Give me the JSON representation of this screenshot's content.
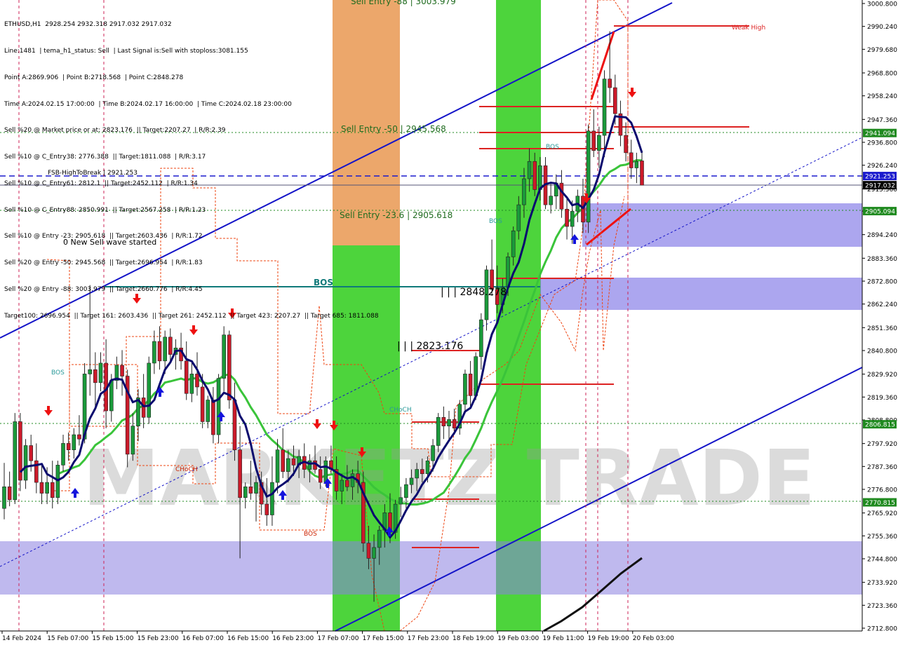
{
  "header": {
    "symbol_line": "ETHUSD,H1  2928.254 2932.318 2917.032 2917.032",
    "info_lines": [
      "Line:1481  | tema_h1_status: Sell  | Last Signal is:Sell with stoploss:3081.155",
      "Point A:2869.906  | Point B:2718.568  | Point C:2848.278",
      "Time A:2024.02.15 17:00:00  | Time B:2024.02.17 16:00:00  | Time C:2024.02.18 23:00:00",
      "Sell %20 @ Market price or at: 2823.176  || Target:2207.27  | R/R:2.39",
      "Sell %10 @ C_Entry38: 2776.388  || Target:1811.088  | R/R:3.17",
      "Sell %10 @ C_Entry61: 2812.1  || Target:2452.112  | R/R:1.34",
      "Sell %10 @ C_Entry88: 2850.991  || Target:2567.258  | R/R:1.23",
      "Sell %10 @ Entry -23: 2905.618  || Target:2603.436  | R/R:1.72",
      "Sell %20 @ Entry -50: 2945.568  || Target:2696.954  | R/R:1.83",
      "Sell %20 @ Entry -88: 3003.979  || Target:2660.776  | R/R:4.45",
      "Target100: 2696.954  || Target 161: 2603.436  || Target 261: 2452.112  || Target 423: 2207.27  || Target 685: 1811.088"
    ]
  },
  "watermark": "MARKETZ TRADE",
  "chart_data": {
    "type": "candlestick",
    "symbol": "ETHUSD",
    "timeframe": "H1",
    "ohlc_last": {
      "open": 2928.254,
      "high": 2932.318,
      "low": 2917.032,
      "close": 2917.032
    },
    "ylim": [
      2712.8,
      3000.8
    ],
    "y_ticks": [
      "3000.800",
      "2990.240",
      "2979.680",
      "2968.800",
      "2958.240",
      "2947.360",
      "2936.800",
      "2926.240",
      "2915.360",
      "2905.094",
      "2894.240",
      "2883.360",
      "2872.800",
      "2862.240",
      "2851.360",
      "2840.800",
      "2829.920",
      "2819.360",
      "2808.800",
      "2797.920",
      "2787.360",
      "2776.800",
      "2765.920",
      "2755.360",
      "2744.800",
      "2733.920",
      "2723.360",
      "2712.800"
    ],
    "x_ticks": [
      "14 Feb 2024",
      "15 Feb 07:00",
      "15 Feb 15:00",
      "15 Feb 23:00",
      "16 Feb 07:00",
      "16 Feb 15:00",
      "16 Feb 23:00",
      "17 Feb 07:00",
      "17 Feb 15:00",
      "17 Feb 23:00",
      "18 Feb 19:00",
      "19 Feb 03:00",
      "19 Feb 11:00",
      "19 Feb 19:00",
      "20 Feb 03:00"
    ],
    "price_badges": [
      {
        "value": "2941.094",
        "color": "#1f8a1f"
      },
      {
        "value": "2921.253",
        "color": "#1a1acd"
      },
      {
        "value": "2917.032",
        "color": "#000000"
      },
      {
        "value": "2905.094",
        "color": "#1f8a1f"
      },
      {
        "value": "2806.815",
        "color": "#1f8a1f"
      },
      {
        "value": "2770.815",
        "color": "#1f8a1f"
      }
    ],
    "annotations": [
      {
        "text": "Sell Entry -88 | 3003.979",
        "color": "#1f6b1f"
      },
      {
        "text": "Sell Entry -50 | 2945.568",
        "color": "#1f6b1f"
      },
      {
        "text": "Sell Entry -23.6 | 2905.618",
        "color": "#1f6b1f"
      },
      {
        "text": "FSB-HighToBreak  |  2921.253",
        "color": "#000000"
      },
      {
        "text": "0 New Sell wave started",
        "color": "#000000"
      },
      {
        "text": "BOS",
        "color": "#0f7a7a"
      },
      {
        "text": "BOS",
        "color": "#2a9a9a"
      },
      {
        "text": "BOS",
        "color": "#2a9a9a"
      },
      {
        "text": "BOS",
        "color": "#2a9a9a"
      },
      {
        "text": "BOS",
        "color": "#cc2200"
      },
      {
        "text": "CHoCH",
        "color": "#2a9a9a"
      },
      {
        "text": "CHoCH",
        "color": "#cc2200"
      },
      {
        "text": "| | | 2848.278",
        "color": "#000000"
      },
      {
        "text": "| | | 2823.176",
        "color": "#000000"
      },
      {
        "text": "Weak High",
        "color": "#dd2222"
      }
    ],
    "candles": [
      {
        "o": 2768,
        "h": 2789,
        "l": 2763,
        "c": 2778
      },
      {
        "o": 2778,
        "h": 2785,
        "l": 2769,
        "c": 2772
      },
      {
        "o": 2772,
        "h": 2812,
        "l": 2770,
        "c": 2808
      },
      {
        "o": 2808,
        "h": 2812,
        "l": 2776,
        "c": 2781
      },
      {
        "o": 2781,
        "h": 2800,
        "l": 2777,
        "c": 2797
      },
      {
        "o": 2797,
        "h": 2802,
        "l": 2785,
        "c": 2790
      },
      {
        "o": 2790,
        "h": 2798,
        "l": 2775,
        "c": 2780
      },
      {
        "o": 2780,
        "h": 2788,
        "l": 2770,
        "c": 2775
      },
      {
        "o": 2775,
        "h": 2787,
        "l": 2770,
        "c": 2780
      },
      {
        "o": 2780,
        "h": 2790,
        "l": 2768,
        "c": 2773
      },
      {
        "o": 2773,
        "h": 2790,
        "l": 2770,
        "c": 2788
      },
      {
        "o": 2788,
        "h": 2802,
        "l": 2785,
        "c": 2798
      },
      {
        "o": 2798,
        "h": 2803,
        "l": 2790,
        "c": 2795
      },
      {
        "o": 2795,
        "h": 2805,
        "l": 2791,
        "c": 2802
      },
      {
        "o": 2802,
        "h": 2811,
        "l": 2797,
        "c": 2800
      },
      {
        "o": 2800,
        "h": 2835,
        "l": 2798,
        "c": 2830
      },
      {
        "o": 2830,
        "h": 2871,
        "l": 2820,
        "c": 2832
      },
      {
        "o": 2832,
        "h": 2840,
        "l": 2815,
        "c": 2826
      },
      {
        "o": 2826,
        "h": 2840,
        "l": 2822,
        "c": 2835
      },
      {
        "o": 2835,
        "h": 2846,
        "l": 2805,
        "c": 2813
      },
      {
        "o": 2813,
        "h": 2830,
        "l": 2808,
        "c": 2827
      },
      {
        "o": 2827,
        "h": 2838,
        "l": 2823,
        "c": 2834
      },
      {
        "o": 2834,
        "h": 2841,
        "l": 2820,
        "c": 2829
      },
      {
        "o": 2829,
        "h": 2832,
        "l": 2787,
        "c": 2793
      },
      {
        "o": 2793,
        "h": 2812,
        "l": 2790,
        "c": 2806
      },
      {
        "o": 2806,
        "h": 2823,
        "l": 2799,
        "c": 2819
      },
      {
        "o": 2819,
        "h": 2830,
        "l": 2805,
        "c": 2810
      },
      {
        "o": 2810,
        "h": 2838,
        "l": 2807,
        "c": 2835
      },
      {
        "o": 2835,
        "h": 2850,
        "l": 2830,
        "c": 2845
      },
      {
        "o": 2845,
        "h": 2852,
        "l": 2832,
        "c": 2836
      },
      {
        "o": 2836,
        "h": 2850,
        "l": 2830,
        "c": 2847
      },
      {
        "o": 2847,
        "h": 2851,
        "l": 2835,
        "c": 2839
      },
      {
        "o": 2839,
        "h": 2846,
        "l": 2832,
        "c": 2842
      },
      {
        "o": 2842,
        "h": 2849,
        "l": 2832,
        "c": 2836
      },
      {
        "o": 2836,
        "h": 2845,
        "l": 2818,
        "c": 2821
      },
      {
        "o": 2821,
        "h": 2835,
        "l": 2817,
        "c": 2830
      },
      {
        "o": 2830,
        "h": 2840,
        "l": 2820,
        "c": 2824
      },
      {
        "o": 2824,
        "h": 2830,
        "l": 2805,
        "c": 2808
      },
      {
        "o": 2808,
        "h": 2820,
        "l": 2805,
        "c": 2818
      },
      {
        "o": 2818,
        "h": 2824,
        "l": 2798,
        "c": 2802
      },
      {
        "o": 2802,
        "h": 2830,
        "l": 2798,
        "c": 2828
      },
      {
        "o": 2828,
        "h": 2852,
        "l": 2822,
        "c": 2848
      },
      {
        "o": 2848,
        "h": 2850,
        "l": 2814,
        "c": 2818
      },
      {
        "o": 2818,
        "h": 2826,
        "l": 2790,
        "c": 2795
      },
      {
        "o": 2795,
        "h": 2806,
        "l": 2745,
        "c": 2773
      },
      {
        "o": 2773,
        "h": 2780,
        "l": 2768,
        "c": 2778
      },
      {
        "o": 2778,
        "h": 2790,
        "l": 2772,
        "c": 2775
      },
      {
        "o": 2775,
        "h": 2783,
        "l": 2762,
        "c": 2780
      },
      {
        "o": 2780,
        "h": 2785,
        "l": 2765,
        "c": 2770
      },
      {
        "o": 2770,
        "h": 2782,
        "l": 2760,
        "c": 2765
      },
      {
        "o": 2765,
        "h": 2792,
        "l": 2760,
        "c": 2780
      },
      {
        "o": 2780,
        "h": 2800,
        "l": 2775,
        "c": 2795
      },
      {
        "o": 2795,
        "h": 2805,
        "l": 2782,
        "c": 2785
      },
      {
        "o": 2785,
        "h": 2795,
        "l": 2780,
        "c": 2791
      },
      {
        "o": 2791,
        "h": 2797,
        "l": 2783,
        "c": 2788
      },
      {
        "o": 2788,
        "h": 2795,
        "l": 2782,
        "c": 2792
      },
      {
        "o": 2792,
        "h": 2798,
        "l": 2782,
        "c": 2786
      },
      {
        "o": 2786,
        "h": 2793,
        "l": 2780,
        "c": 2790
      },
      {
        "o": 2790,
        "h": 2797,
        "l": 2784,
        "c": 2786
      },
      {
        "o": 2786,
        "h": 2792,
        "l": 2777,
        "c": 2780
      },
      {
        "o": 2780,
        "h": 2792,
        "l": 2778,
        "c": 2790
      },
      {
        "o": 2790,
        "h": 2797,
        "l": 2784,
        "c": 2786
      },
      {
        "o": 2786,
        "h": 2792,
        "l": 2772,
        "c": 2776
      },
      {
        "o": 2776,
        "h": 2784,
        "l": 2770,
        "c": 2781
      },
      {
        "o": 2781,
        "h": 2788,
        "l": 2776,
        "c": 2778
      },
      {
        "o": 2778,
        "h": 2786,
        "l": 2772,
        "c": 2784
      },
      {
        "o": 2784,
        "h": 2790,
        "l": 2775,
        "c": 2780
      },
      {
        "o": 2780,
        "h": 2785,
        "l": 2748,
        "c": 2752
      },
      {
        "o": 2752,
        "h": 2760,
        "l": 2740,
        "c": 2745
      },
      {
        "o": 2745,
        "h": 2756,
        "l": 2725,
        "c": 2750
      },
      {
        "o": 2750,
        "h": 2760,
        "l": 2742,
        "c": 2758
      },
      {
        "o": 2758,
        "h": 2770,
        "l": 2750,
        "c": 2766
      },
      {
        "o": 2766,
        "h": 2775,
        "l": 2752,
        "c": 2757
      },
      {
        "o": 2757,
        "h": 2772,
        "l": 2754,
        "c": 2770
      },
      {
        "o": 2770,
        "h": 2778,
        "l": 2764,
        "c": 2773
      },
      {
        "o": 2773,
        "h": 2782,
        "l": 2768,
        "c": 2779
      },
      {
        "o": 2779,
        "h": 2786,
        "l": 2775,
        "c": 2782
      },
      {
        "o": 2782,
        "h": 2789,
        "l": 2776,
        "c": 2786
      },
      {
        "o": 2786,
        "h": 2791,
        "l": 2780,
        "c": 2784
      },
      {
        "o": 2784,
        "h": 2792,
        "l": 2780,
        "c": 2790
      },
      {
        "o": 2790,
        "h": 2800,
        "l": 2785,
        "c": 2797
      },
      {
        "o": 2797,
        "h": 2812,
        "l": 2794,
        "c": 2810
      },
      {
        "o": 2810,
        "h": 2815,
        "l": 2800,
        "c": 2806
      },
      {
        "o": 2806,
        "h": 2813,
        "l": 2800,
        "c": 2809
      },
      {
        "o": 2809,
        "h": 2814,
        "l": 2802,
        "c": 2805
      },
      {
        "o": 2805,
        "h": 2818,
        "l": 2802,
        "c": 2816
      },
      {
        "o": 2816,
        "h": 2832,
        "l": 2812,
        "c": 2830
      },
      {
        "o": 2830,
        "h": 2836,
        "l": 2815,
        "c": 2820
      },
      {
        "o": 2820,
        "h": 2840,
        "l": 2818,
        "c": 2838
      },
      {
        "o": 2838,
        "h": 2858,
        "l": 2832,
        "c": 2855
      },
      {
        "o": 2855,
        "h": 2880,
        "l": 2850,
        "c": 2878
      },
      {
        "o": 2878,
        "h": 2892,
        "l": 2866,
        "c": 2869
      },
      {
        "o": 2869,
        "h": 2880,
        "l": 2858,
        "c": 2862
      },
      {
        "o": 2862,
        "h": 2874,
        "l": 2858,
        "c": 2870
      },
      {
        "o": 2870,
        "h": 2886,
        "l": 2866,
        "c": 2884
      },
      {
        "o": 2884,
        "h": 2898,
        "l": 2880,
        "c": 2896
      },
      {
        "o": 2896,
        "h": 2912,
        "l": 2892,
        "c": 2908
      },
      {
        "o": 2908,
        "h": 2925,
        "l": 2902,
        "c": 2920
      },
      {
        "o": 2920,
        "h": 2934,
        "l": 2914,
        "c": 2928
      },
      {
        "o": 2928,
        "h": 2932,
        "l": 2912,
        "c": 2915
      },
      {
        "o": 2915,
        "h": 2930,
        "l": 2910,
        "c": 2926
      },
      {
        "o": 2926,
        "h": 2930,
        "l": 2906,
        "c": 2908
      },
      {
        "o": 2908,
        "h": 2918,
        "l": 2904,
        "c": 2912
      },
      {
        "o": 2912,
        "h": 2922,
        "l": 2906,
        "c": 2918
      },
      {
        "o": 2918,
        "h": 2924,
        "l": 2902,
        "c": 2906
      },
      {
        "o": 2906,
        "h": 2912,
        "l": 2892,
        "c": 2898
      },
      {
        "o": 2898,
        "h": 2910,
        "l": 2890,
        "c": 2905
      },
      {
        "o": 2905,
        "h": 2915,
        "l": 2900,
        "c": 2912
      },
      {
        "o": 2912,
        "h": 2920,
        "l": 2895,
        "c": 2900
      },
      {
        "o": 2900,
        "h": 2945,
        "l": 2895,
        "c": 2942
      },
      {
        "o": 2942,
        "h": 2952,
        "l": 2930,
        "c": 2933
      },
      {
        "o": 2933,
        "h": 2944,
        "l": 2925,
        "c": 2940
      },
      {
        "o": 2940,
        "h": 2970,
        "l": 2930,
        "c": 2966
      },
      {
        "o": 2966,
        "h": 2988,
        "l": 2955,
        "c": 2962
      },
      {
        "o": 2962,
        "h": 2968,
        "l": 2945,
        "c": 2950
      },
      {
        "o": 2950,
        "h": 2956,
        "l": 2935,
        "c": 2940
      },
      {
        "o": 2940,
        "h": 2946,
        "l": 2928,
        "c": 2932
      },
      {
        "o": 2932,
        "h": 2938,
        "l": 2920,
        "c": 2925
      },
      {
        "o": 2925,
        "h": 2932,
        "l": 2918,
        "c": 2928
      },
      {
        "o": 2928.254,
        "h": 2932.318,
        "l": 2917.032,
        "c": 2917.032
      }
    ]
  }
}
